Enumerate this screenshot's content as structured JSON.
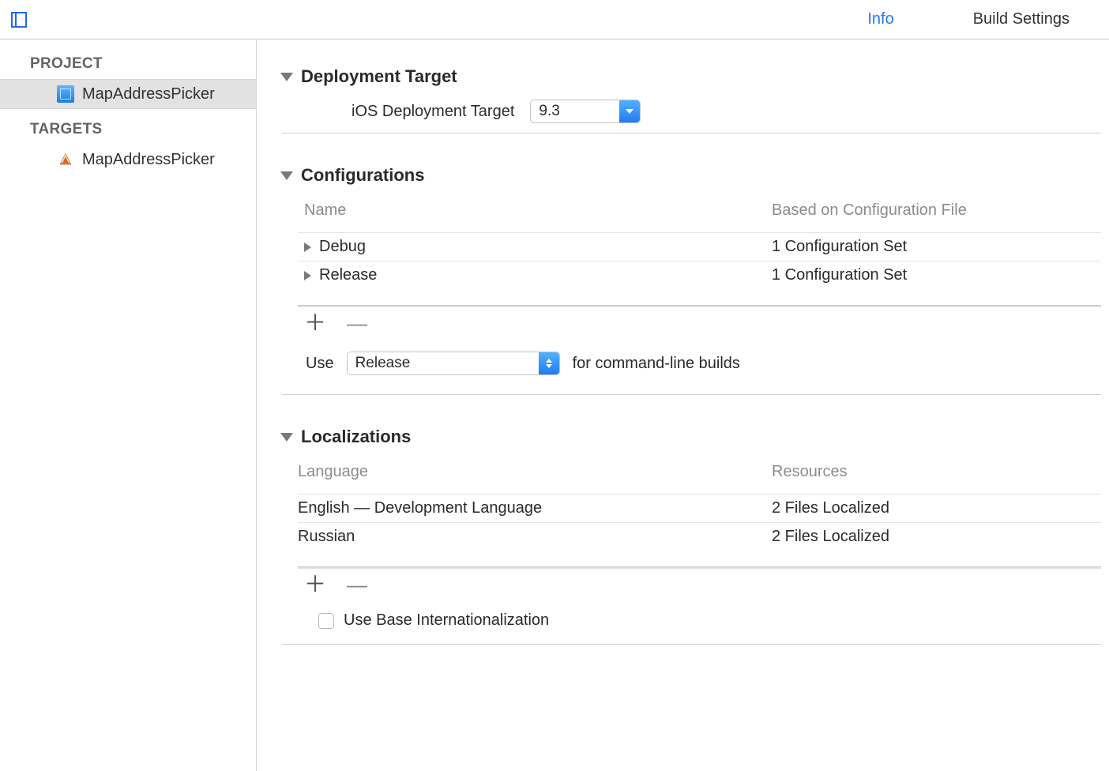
{
  "tabs": {
    "info": "Info",
    "build_settings": "Build Settings"
  },
  "sidebar": {
    "project_header": "PROJECT",
    "project_name": "MapAddressPicker",
    "targets_header": "TARGETS",
    "target_name": "MapAddressPicker"
  },
  "sections": {
    "deployment": {
      "title": "Deployment Target",
      "label": "iOS Deployment Target",
      "value": "9.3"
    },
    "configurations": {
      "title": "Configurations",
      "head_name": "Name",
      "head_based": "Based on Configuration File",
      "rows": [
        {
          "name": "Debug",
          "based": "1 Configuration Set"
        },
        {
          "name": "Release",
          "based": "1 Configuration Set"
        }
      ],
      "use_label": "Use",
      "use_value": "Release",
      "use_suffix": "for command-line builds"
    },
    "localizations": {
      "title": "Localizations",
      "head_lang": "Language",
      "head_res": "Resources",
      "rows": [
        {
          "lang": "English — Development Language",
          "res": "2 Files Localized"
        },
        {
          "lang": "Russian",
          "res": "2 Files Localized"
        }
      ],
      "base_checkbox_label": "Use Base Internationalization"
    }
  },
  "glyphs": {
    "plus": "＋",
    "minus": "—"
  }
}
